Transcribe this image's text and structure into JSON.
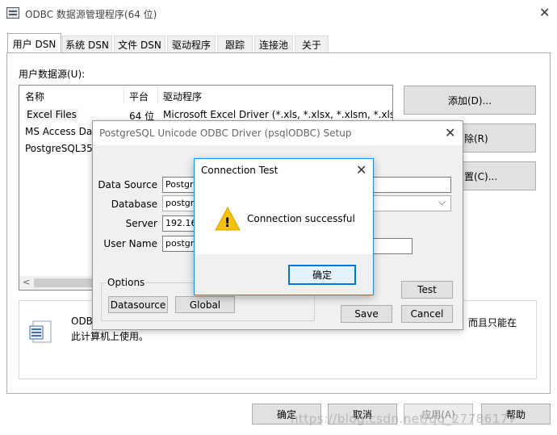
{
  "main_window": {
    "title": "ODBC 数据源管理程序(64 位)",
    "tabs": [
      "用户 DSN",
      "系统 DSN",
      "文件 DSN",
      "驱动程序",
      "跟踪",
      "连接池",
      "关于"
    ],
    "list_label": "用户数据源(U):",
    "columns": [
      "名称",
      "平台",
      "驱动程序"
    ],
    "rows": [
      {
        "name": "Excel Files",
        "platform": "64 位",
        "driver": "Microsoft Excel Driver (*.xls, *.xlsx, *.xlsm, *.xlsb)"
      },
      {
        "name": "MS Access Dat",
        "platform": "",
        "driver": ""
      },
      {
        "name": "PostgreSQL35W",
        "platform": "",
        "driver": ""
      }
    ],
    "side_buttons": {
      "add": "添加(D)...",
      "remove": "除(R)",
      "configure": "置(C)..."
    },
    "info_text_line1": "ODB",
    "info_text_line1_right": "，而且只能在",
    "info_text_line2": "此计算机上使用。",
    "bottom_buttons": {
      "ok": "确定",
      "cancel": "取消",
      "apply": "应用(A)",
      "help": "帮助"
    },
    "watermark": "https://blog.csdn.net/qq_27786177"
  },
  "setup_dialog": {
    "title": "PostgreSQL Unicode ODBC Driver (psqlODBC) Setup",
    "labels": {
      "data_source": "Data Source",
      "database": "Database",
      "server": "Server",
      "user_name": "User Name"
    },
    "values": {
      "data_source": "Postgre",
      "database": "postgre",
      "server": "192.168",
      "user_name": "postgre"
    },
    "options_label": "Options",
    "buttons": {
      "datasource": "Datasource",
      "global": "Global",
      "test": "Test",
      "save": "Save",
      "cancel": "Cancel"
    }
  },
  "connection_test": {
    "title": "Connection Test",
    "message": "Connection successful",
    "ok": "确定",
    "warning_glyph": "!"
  },
  "colors": {
    "accent": "#0078d7",
    "warning": "#f4c20d",
    "button_face": "#e1e1e1",
    "dialog_bg": "#f0f0f0"
  }
}
